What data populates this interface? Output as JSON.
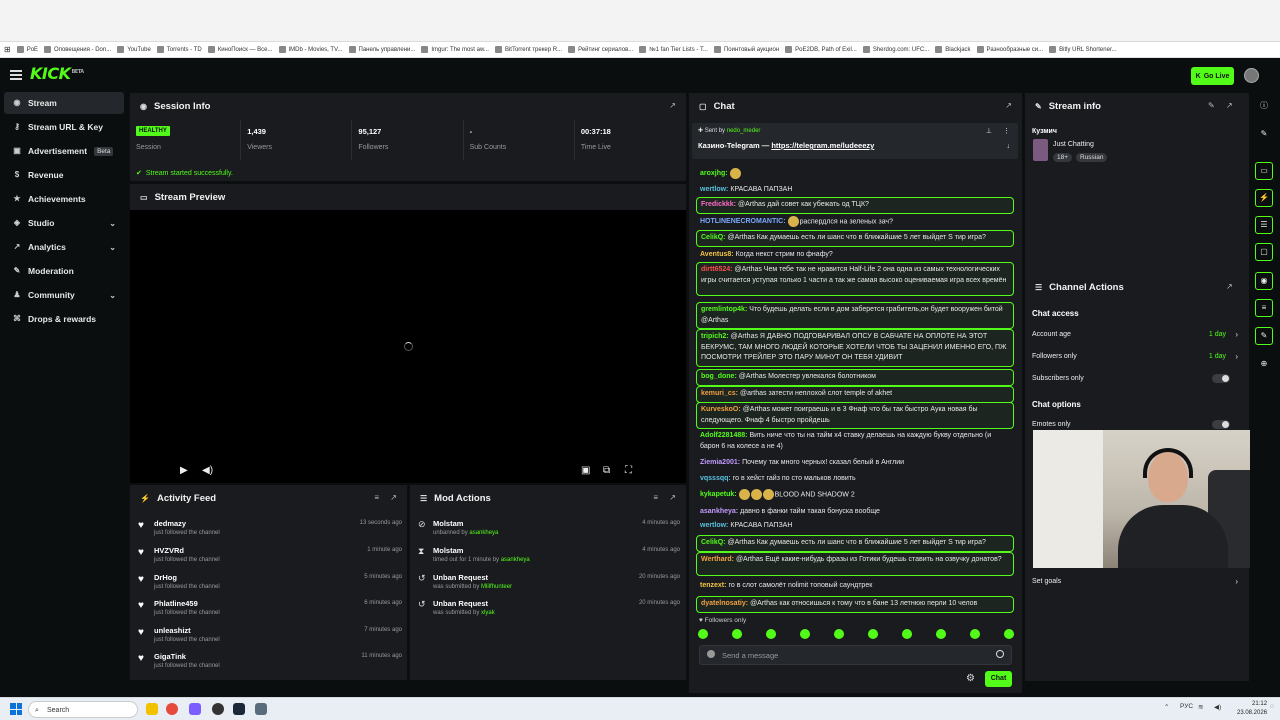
{
  "bookmarks": [
    "PoE",
    "Оповещения - Don...",
    "YouTube",
    "Torrents - TD",
    "КиноПоиск — Все...",
    "IMDb - Movies, TV...",
    "Панель управлени...",
    "Imgur: The most aw...",
    "BitTorrent трекер R...",
    "Рейтинг сериалов...",
    "№1 fan Tier Lists - T...",
    "Поинтовый аукцион",
    "PoE2DB, Path of Exil...",
    "Sherdog.com: UFC...",
    "Blackjack",
    "Разнообразные си...",
    "Bitly URL Shortener..."
  ],
  "header": {
    "logo": "KICK",
    "logo_tag": "BETA",
    "go_live": "Go Live"
  },
  "sidebar": {
    "items": [
      {
        "label": "Stream",
        "icon": "radio-icon"
      },
      {
        "label": "Stream URL & Key",
        "icon": "key-icon"
      },
      {
        "label": "Advertisement",
        "icon": "ad-icon",
        "badge": "Beta"
      },
      {
        "label": "Revenue",
        "icon": "dollar-icon"
      },
      {
        "label": "Achievements",
        "icon": "star-icon"
      },
      {
        "label": "Studio",
        "icon": "studio-icon"
      },
      {
        "label": "Analytics",
        "icon": "chart-icon"
      },
      {
        "label": "Moderation",
        "icon": "wrench-icon"
      },
      {
        "label": "Community",
        "icon": "users-icon"
      },
      {
        "label": "Drops & rewards",
        "icon": "gift-icon"
      }
    ]
  },
  "session": {
    "title": "Session Info",
    "status": "HEALTHY",
    "status_label": "Session",
    "stats": [
      {
        "value": "1,439",
        "label": "Viewers"
      },
      {
        "value": "95,127",
        "label": "Followers"
      },
      {
        "value": "-",
        "label": "Sub Counts"
      },
      {
        "value": "00:37:18",
        "label": "Time Live"
      }
    ],
    "notice": "Stream started successfully."
  },
  "preview": {
    "title": "Stream Preview"
  },
  "activity": {
    "title": "Activity Feed",
    "items": [
      {
        "name": "dedmazy",
        "sub": "just followed the channel",
        "time": "13 seconds ago"
      },
      {
        "name": "HVZVRd",
        "sub": "just followed the channel",
        "time": "1 minute ago"
      },
      {
        "name": "DrHog",
        "sub": "just followed the channel",
        "time": "5 minutes ago"
      },
      {
        "name": "Phlatline459",
        "sub": "just followed the channel",
        "time": "6 minutes ago"
      },
      {
        "name": "unleashizt",
        "sub": "just followed the channel",
        "time": "7 minutes ago"
      },
      {
        "name": "GigaTink",
        "sub": "just followed the channel",
        "time": "11 minutes ago"
      }
    ]
  },
  "mod": {
    "title": "Mod Actions",
    "items": [
      {
        "name": "Molstam",
        "sub": "unbanned by",
        "by": "asankheya",
        "time": "4 minutes ago",
        "icon": "unban-icon"
      },
      {
        "name": "Molstam",
        "sub": "timed out for 1 minute by",
        "by": "asankheya",
        "time": "4 minutes ago",
        "icon": "hourglass-icon"
      },
      {
        "name": "Unban Request",
        "sub": "was submitted by",
        "by": "Mlilfhunteer",
        "time": "20 minutes ago",
        "icon": "history-icon"
      },
      {
        "name": "Unban Request",
        "sub": "was submitted by",
        "by": "xlyak",
        "time": "20 minutes ago",
        "icon": "history-icon"
      }
    ]
  },
  "chat": {
    "title": "Chat",
    "pinned": {
      "sent_by": "Sent by",
      "sender": "nedo_meder",
      "text": "Казино-Telegram — ",
      "link": "https://telegram.me/ludeeezy"
    },
    "messages": [
      {
        "user": "aroxjhg:",
        "text": "",
        "color": "#53fc18",
        "hl": false,
        "emo": 1
      },
      {
        "user": "wertlow:",
        "text": "КРАСАВА ПАПЗАН",
        "color": "#5bc0de",
        "hl": false
      },
      {
        "user": "Fredickkk:",
        "text": "@Arthas дай совет как убежать од ТЦК?",
        "color": "#ff6bcb",
        "hl": true
      },
      {
        "user": "HOTLINENECROMANTIC:",
        "text": "распердлся на зеленых зач?",
        "color": "#7aa8ff",
        "hl": false,
        "emo": 1
      },
      {
        "user": "CelikQ:",
        "text": "@Arthas Как думаешь есть ли шанс что в ближайшие 5 лет выйдет S тир игра?",
        "color": "#53fc18",
        "hl": true
      },
      {
        "user": "Aventus8:",
        "text": "Когда некст стрим по фнафу?",
        "color": "#f5c542",
        "hl": false
      },
      {
        "user": "dirtt6524:",
        "text": "@Arthas Чем тебе так не нравится Half-Life 2 она одна из самых технологических игры считается уступая только 1 части а так же самая высоко оцениваемая игра всех времён",
        "color": "#ff4d4d",
        "hl": true
      },
      {
        "user": "gremlintop4k:",
        "text": "Что будешь делать если в дом заберется грабитель,он будет вооружен битой @Arthas",
        "color": "#53fc18",
        "hl": true
      },
      {
        "user": "tripich2:",
        "text": "@Arthas Я ДАВНО ПОДГОВАРИВАЛ ОПСУ В САБЧАТЕ НА ОПЛОТЕ НА ЭТОТ БЕКРУМС, ТАМ МНОГО ЛЮДЕЙ КОТОРЫЕ ХОТЕЛИ ЧТОБ ТЫ ЗАЦЕНИЛ ИМЕННО ЕГО, ПЖ ПОСМОТРИ ТРЕЙЛЕР ЭТО ПАРУ МИНУТ ОН ТЕБЯ УДИВИТ",
        "color": "#53fc18",
        "hl": true
      },
      {
        "user": "bog_done:",
        "text": "@Arthas Молестер увлекался болотником",
        "color": "#53fc18",
        "hl": true
      },
      {
        "user": "kemuri_cs:",
        "text": "@arthas затести неплохой слот temple of akhet",
        "color": "#f5a142",
        "hl": true
      },
      {
        "user": "KurveskoO:",
        "text": "@Arthas может поиграешь и в 3 Фнаф что бы так быстро Аука новая бы следующего. Фнаф 4 быстро пройдешь",
        "color": "#f5a142",
        "hl": true
      },
      {
        "user": "Adolf2281488:",
        "text": "Вить ниче что ты на тайм х4 ставку делаешь на каждую букву отдельно (и барон 6 на колесе а не 4)",
        "color": "#53fc18",
        "hl": false
      },
      {
        "user": "Ziemia2001:",
        "text": "Почему так много черных! сказал белый в Англии",
        "color": "#c39bff",
        "hl": false
      },
      {
        "user": "vqsssqq:",
        "text": "го в хейст гайз по сто мальков ловить",
        "color": "#5bc0de",
        "hl": false
      },
      {
        "user": "kykapetuk:",
        "text": "BLOOD AND SHADOW 2",
        "color": "#53fc18",
        "hl": false,
        "emo": 3
      },
      {
        "user": "asankheya:",
        "text": "давно в фанки тайм такая бонуска вообще",
        "color": "#c39bff",
        "hl": false
      },
      {
        "user": "wertlow:",
        "text": "КРАСАВА ПАПЗАН",
        "color": "#5bc0de",
        "hl": false
      },
      {
        "user": "CelikQ:",
        "text": "@Arthas Как думаешь есть ли шанс что в ближайшие 5 лет выйдет S тир игра?",
        "color": "#53fc18",
        "hl": true
      },
      {
        "user": "Werthard:",
        "text": "@Arthas Ещё какие-нибудь фразы из Готики будешь ставить на озвучку донатов?",
        "color": "#f5a142",
        "hl": true
      },
      {
        "user": "tenzext:",
        "text": "го в слот самолёт nolimit топовый саундтрек",
        "color": "#f5c542",
        "hl": false
      },
      {
        "user": "dyatelnosatiy:",
        "text": "@Arthas как относишься к тому что в бане 13 летнюю перли 10 челов",
        "color": "#f5a142",
        "hl": true
      }
    ],
    "followers_only": "Followers only",
    "placeholder": "Send a message",
    "send_label": "Chat"
  },
  "stream_info": {
    "title": "Stream info",
    "channel": "Кузмич",
    "category": "Just Chatting",
    "tags": [
      "18+",
      "Russian"
    ]
  },
  "channel_actions": {
    "title": "Channel Actions",
    "access_title": "Chat access",
    "rows": [
      {
        "label": "Account age",
        "value": "1 day"
      },
      {
        "label": "Followers only",
        "value": "1 day"
      },
      {
        "label": "Subscribers only",
        "value": ""
      }
    ],
    "options_title": "Chat options",
    "emotes_only": "Emotes only",
    "set_goals": "Set goals"
  },
  "taskbar": {
    "search": "Search",
    "lang": "РУС",
    "time": "21:12",
    "date": "23.08.2026"
  },
  "colors": {
    "accent": "#53fc18",
    "panel": "#191b1f",
    "bg": "#0b0e0f"
  }
}
